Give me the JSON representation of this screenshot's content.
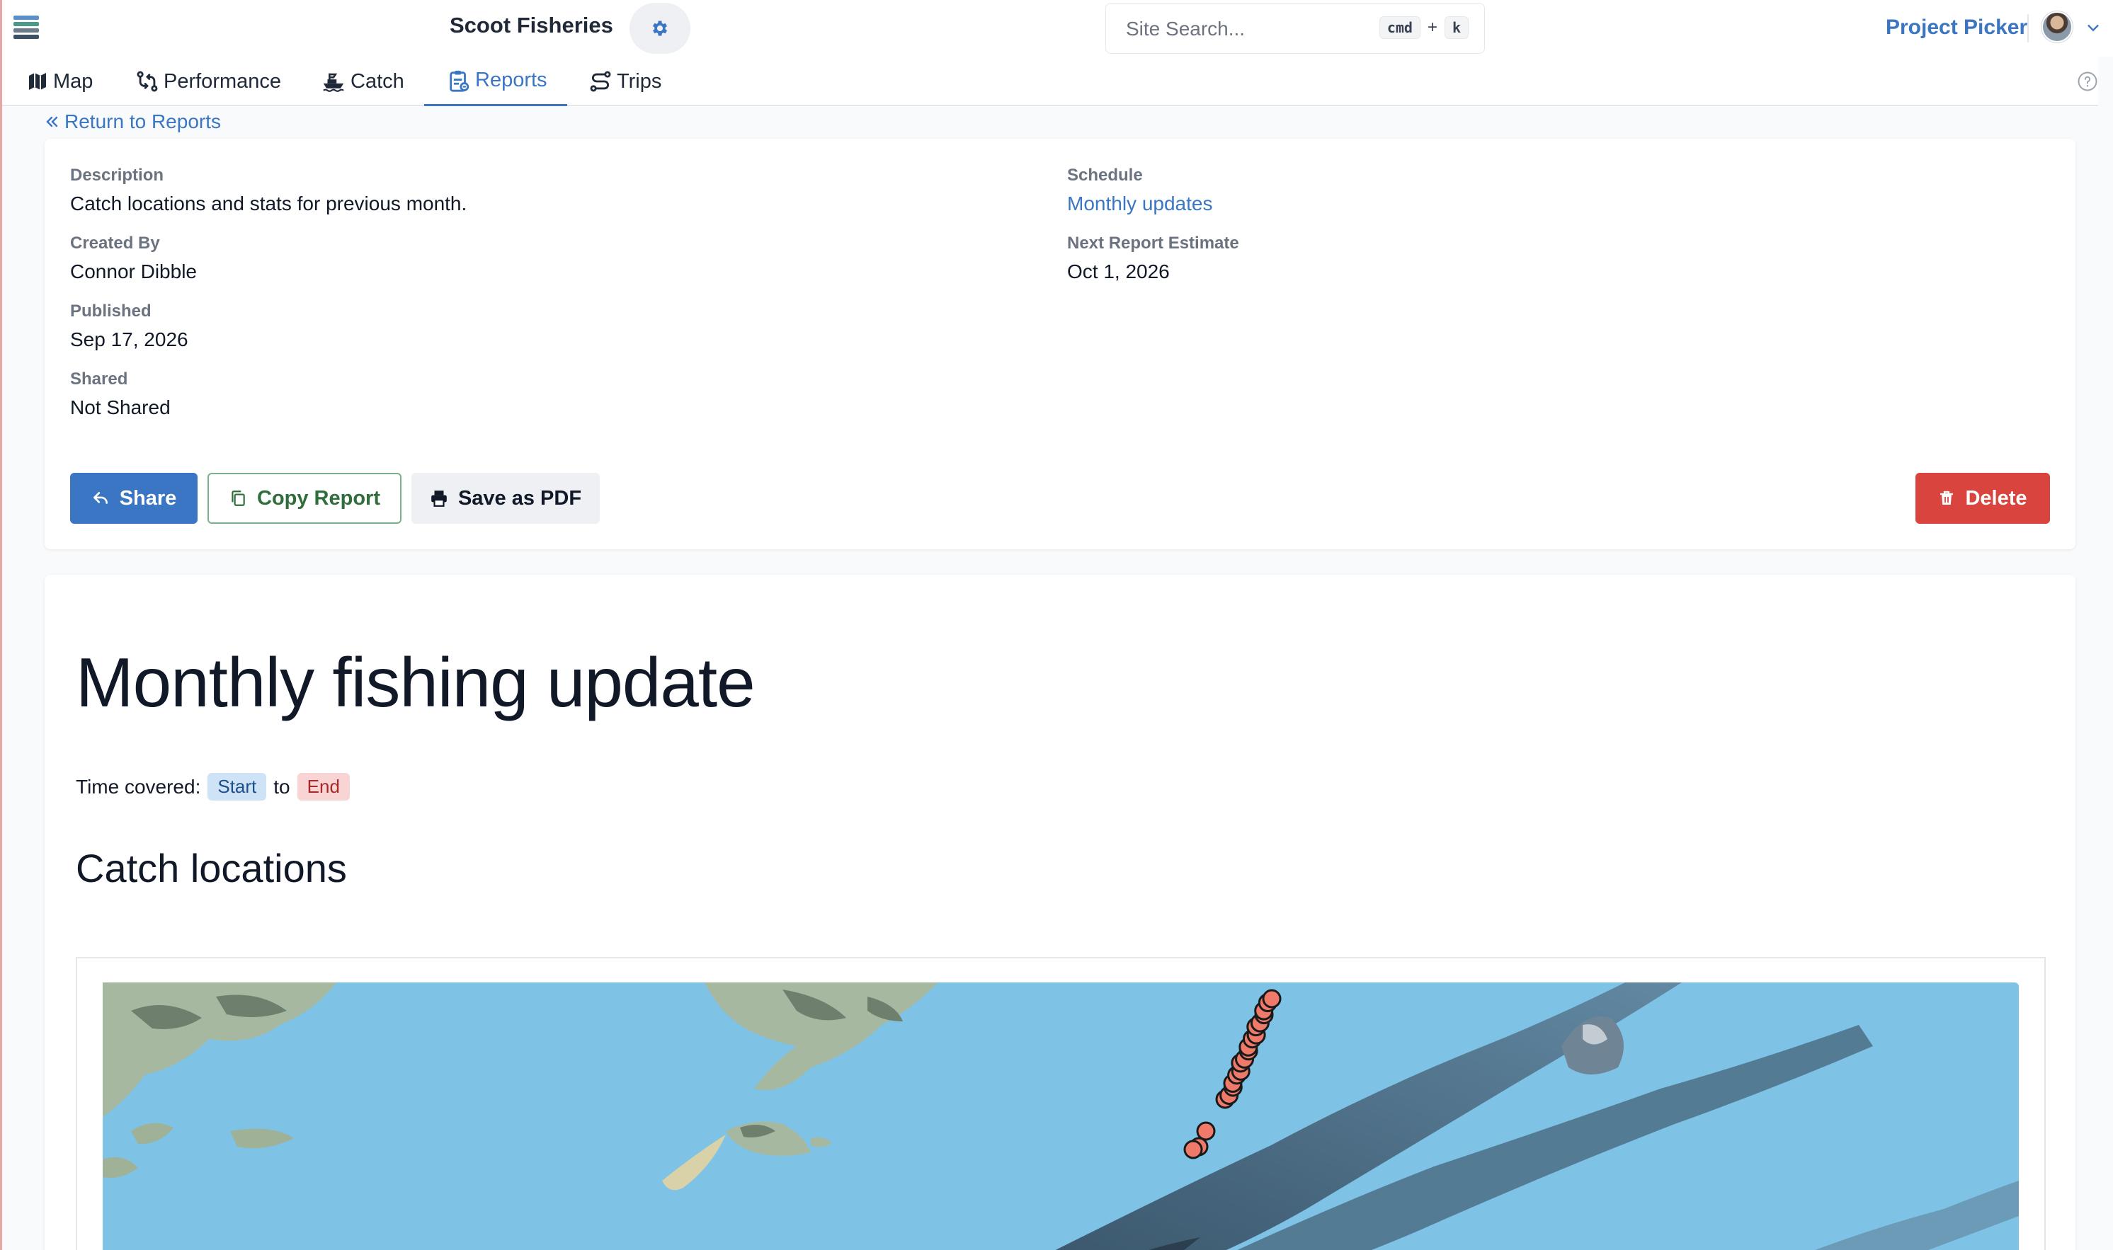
{
  "header": {
    "app_title": "Scoot Fisheries",
    "search": {
      "placeholder": "Site Search...",
      "shortcut_modifier": "cmd",
      "shortcut_plus": "+",
      "shortcut_key": "k"
    },
    "project_picker": "Project Picker"
  },
  "nav": {
    "tabs": [
      {
        "label": "Map",
        "icon": "map-icon"
      },
      {
        "label": "Performance",
        "icon": "performance-icon"
      },
      {
        "label": "Catch",
        "icon": "boat-icon"
      },
      {
        "label": "Reports",
        "icon": "clipboard-icon",
        "active": true
      },
      {
        "label": "Trips",
        "icon": "route-icon"
      }
    ]
  },
  "return_link": "Return to Reports",
  "report_info": {
    "description_label": "Description",
    "description": "Catch locations and stats for previous month.",
    "created_by_label": "Created By",
    "created_by": "Connor Dibble",
    "published_label": "Published",
    "published": "Sep 17, 2026",
    "shared_label": "Shared",
    "shared": "Not Shared",
    "schedule_label": "Schedule",
    "schedule": "Monthly updates",
    "next_estimate_label": "Next Report Estimate",
    "next_estimate": "Oct 1, 2026"
  },
  "actions": {
    "share": "Share",
    "copy": "Copy Report",
    "pdf": "Save as PDF",
    "delete": "Delete"
  },
  "report": {
    "title": "Monthly fishing update",
    "time_covered_label": "Time covered:",
    "start": "Start",
    "to": "to",
    "end": "End",
    "section_title": "Catch locations"
  },
  "colors": {
    "primary": "#3b76c4",
    "danger": "#d9443e",
    "catch_marker": "#f07a6a",
    "ocean": "#7ec3e6"
  }
}
